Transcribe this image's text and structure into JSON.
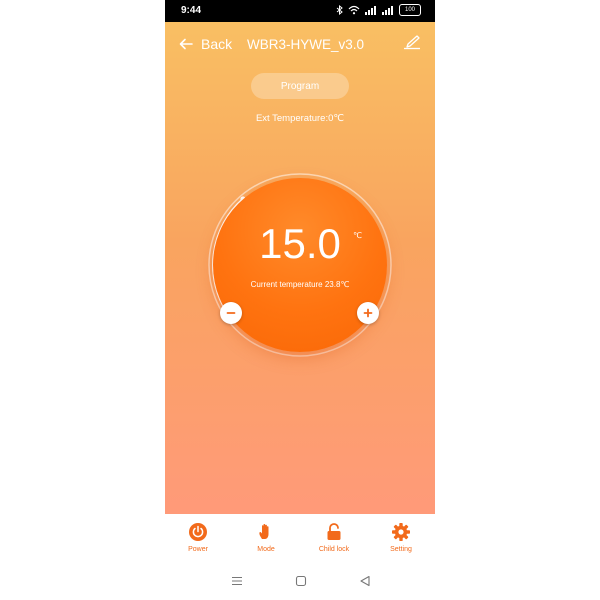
{
  "status_bar": {
    "time": "9:44",
    "battery": "100"
  },
  "header": {
    "back_label": "Back",
    "title": "WBR3-HYWE_v3.0",
    "icons": [
      "back-arrow-icon",
      "edit-pen-icon"
    ]
  },
  "program_button": "Program",
  "ext_temperature": "Ext Temperature:0℃",
  "thermostat": {
    "setpoint": "15.0",
    "unit": "℃",
    "current_temperature": "Current temperature  23.8℃"
  },
  "tabs": [
    {
      "label": "Power",
      "icon": "power-icon"
    },
    {
      "label": "Mode",
      "icon": "hand-icon"
    },
    {
      "label": "Child lock",
      "icon": "unlock-icon"
    },
    {
      "label": "Setting",
      "icon": "gear-icon"
    }
  ],
  "colors": {
    "accent": "#f26a1b",
    "dial": "#ff7310",
    "background_top": "#f9bf63",
    "background_bottom": "#ff9a79"
  }
}
